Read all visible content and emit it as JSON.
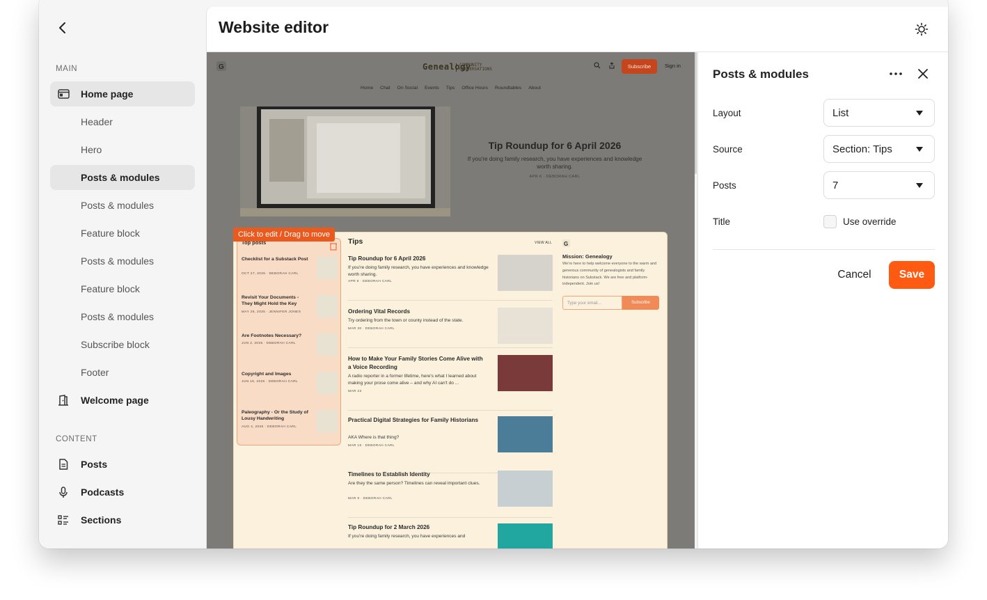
{
  "sidebar": {
    "main_heading": "MAIN",
    "content_heading": "CONTENT",
    "top_items": [
      {
        "label": "Home page",
        "icon": "browser-window-icon"
      },
      {
        "label": "Welcome page",
        "icon": "door-icon"
      }
    ],
    "sub_items": [
      {
        "label": "Header"
      },
      {
        "label": "Hero"
      },
      {
        "label": "Posts & modules"
      },
      {
        "label": "Posts & modules"
      },
      {
        "label": "Feature block"
      },
      {
        "label": "Posts & modules"
      },
      {
        "label": "Feature block"
      },
      {
        "label": "Posts & modules"
      },
      {
        "label": "Subscribe block"
      },
      {
        "label": "Footer"
      }
    ],
    "content_items": [
      {
        "label": "Posts",
        "icon": "document-icon"
      },
      {
        "label": "Podcasts",
        "icon": "microphone-icon"
      },
      {
        "label": "Sections",
        "icon": "list-icon"
      }
    ]
  },
  "main": {
    "title": "Website editor"
  },
  "preview": {
    "wordmark": "Genealogy",
    "wordmark_sub": "COMMUNITY CONVERSATIONS",
    "subscribe": "Subscribe",
    "sign_in": "Sign in",
    "nav": [
      "Home",
      "Chat",
      "On Social",
      "Events",
      "Tips",
      "Office Hours",
      "Roundtables",
      "About"
    ],
    "hero": {
      "title": "Tip Roundup for 6 April 2026",
      "desc": "If you're doing family research, you have experiences and knowledge worth sharing.",
      "meta": "APR 6 · DEBORAH CARL"
    },
    "edit_tag": "Click to edit / Drag to move",
    "top_posts": {
      "heading": "Top posts",
      "items": [
        {
          "title": "Checklist for a Substack Post",
          "meta": "OCT 27, 2025 · DEBORAH CARL"
        },
        {
          "title": "Revisit Your Documents - They Might Hold the Key",
          "meta": "MAY 26, 2025 · JENNIFER JONES"
        },
        {
          "title": "Are Footnotes Necessary?",
          "meta": "JUN 2, 2025 · DEBORAH CARL"
        },
        {
          "title": "Copyright and Images",
          "meta": "JUN 16, 2025 · DEBORAH CARL"
        },
        {
          "title": "Paleography - Or the Study of Lousy Handwriting",
          "meta": "AUG 4, 2025 · DEBORAH CARL"
        }
      ]
    },
    "tips": {
      "heading": "Tips",
      "view_all": "VIEW ALL",
      "items": [
        {
          "title": "Tip Roundup for 6 April 2026",
          "desc": "If you're doing family research, you have experiences and knowledge worth sharing.",
          "meta": "APR 6 · DEBORAH CARL"
        },
        {
          "title": "Ordering Vital Records",
          "desc": "Try ordering from the town or county instead of the state.",
          "meta": "MAR 30 · DEBORAH CARL"
        },
        {
          "title": "How to Make Your Family Stories Come Alive with a Voice Recording",
          "desc": "A radio reporter in a former lifetime, here's what I learned about making your prose come alive – and why AI can't do ...",
          "meta": "MAR 23"
        },
        {
          "title": "Practical Digital Strategies for Family Historians",
          "desc": "AKA Where is that thing?",
          "meta": "MAR 16 · DEBORAH CARL"
        },
        {
          "title": "Timelines to Establish Identity",
          "desc": "Are they the same person? Timelines can reveal important clues.",
          "meta": "MAR 9 · DEBORAH CARL"
        },
        {
          "title": "Tip Roundup for 2 March 2026",
          "desc": "If you're doing family research, you have experiences and",
          "meta": ""
        }
      ]
    },
    "mission": {
      "title": "Mission: Genealogy",
      "desc": "We're here to help welcome everyone to the warm and generous community of genealogists and family historians on Substack. We are free and platform-independent. Join us!",
      "email_placeholder": "Type your email...",
      "subscribe": "Subscribe"
    }
  },
  "settings": {
    "title": "Posts & modules",
    "fields": [
      {
        "label": "Layout",
        "value": "List"
      },
      {
        "label": "Source",
        "value": "Section: Tips"
      },
      {
        "label": "Posts",
        "value": "7"
      }
    ],
    "title_label": "Title",
    "override_label": "Use override",
    "override_checked": false,
    "cancel": "Cancel",
    "save": "Save"
  },
  "colors": {
    "accent": "#ff5a11",
    "module_bg": "#fbf1dc",
    "preview_overlay": "#7d7b77"
  }
}
